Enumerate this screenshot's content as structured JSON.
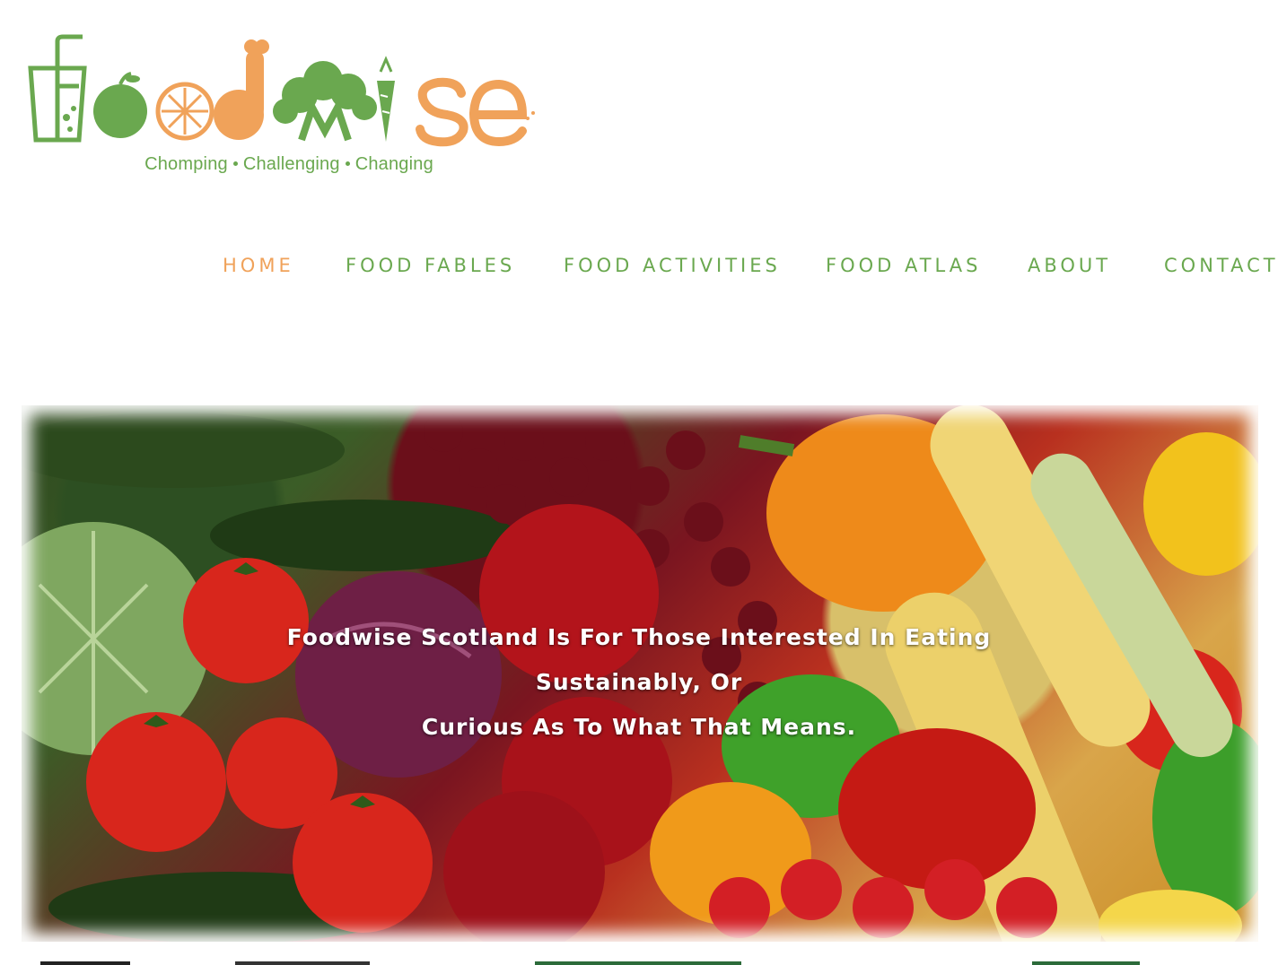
{
  "logo": {
    "name": "Foodwise",
    "tagline_parts": [
      "Chomping",
      "Challenging",
      "Changing"
    ],
    "colors": {
      "green": "#6aa84f",
      "orange": "#f0a25a"
    }
  },
  "nav": {
    "items": [
      {
        "label": "HOME",
        "active": true
      },
      {
        "label": "FOOD FABLES",
        "active": false
      },
      {
        "label": "FOOD ACTIVITIES",
        "active": false
      },
      {
        "label": "FOOD ATLAS",
        "active": false
      },
      {
        "label": "ABOUT",
        "active": false
      },
      {
        "label": "CONTACT",
        "active": false
      }
    ],
    "active_color": "#f0a25a",
    "color": "#6aa84f"
  },
  "hero": {
    "text_line1": "Foodwise Scotland Is For Those Interested In Eating Sustainably, Or",
    "text_line2": "Curious As To What That Means."
  }
}
